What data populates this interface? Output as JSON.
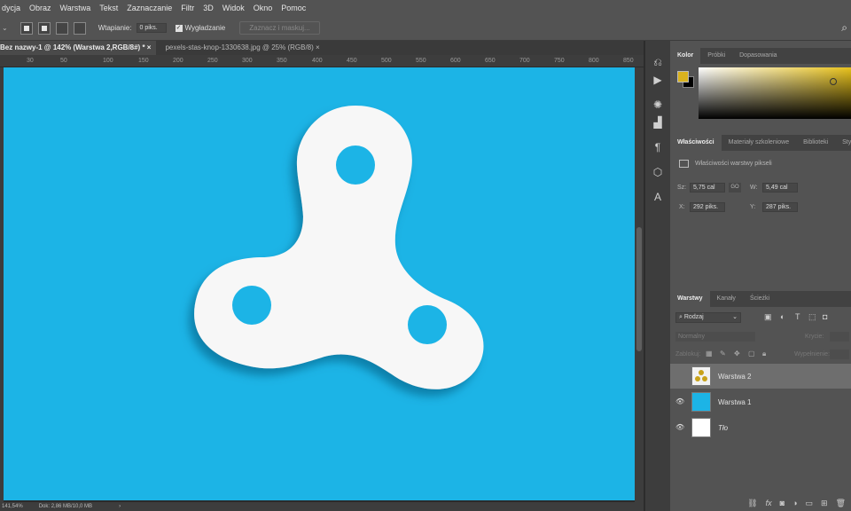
{
  "menu": [
    "dycja",
    "Obraz",
    "Warstwa",
    "Tekst",
    "Zaznaczanie",
    "Filtr",
    "3D",
    "Widok",
    "Okno",
    "Pomoc"
  ],
  "options": {
    "feather_label": "Wtapianie:",
    "feather_value": "0 piks.",
    "antialias_label": "Wygładzanie",
    "select_mask_label": "Zaznacz i maskuj..."
  },
  "tabs": [
    {
      "label": "Bez nazwy-1 @ 142% (Warstwa 2,RGB/8#) *",
      "close": "×"
    },
    {
      "label": "pexels-stas-knop-1330638.jpg @ 25% (RGB/8)",
      "close": "×"
    }
  ],
  "ruler_ticks": [
    "30",
    "50",
    "100",
    "150",
    "200",
    "250",
    "300",
    "350",
    "400",
    "450",
    "500",
    "550",
    "600",
    "650",
    "700",
    "750",
    "800",
    "850",
    "900"
  ],
  "status": {
    "zoom": "141,54%",
    "doc": "Dok: 2,86 MB/10,0 MB"
  },
  "color_panel": {
    "tabs": [
      "Kolor",
      "Próbki",
      "Dopasowania"
    ],
    "fg_color": "#d9b21f",
    "bg_color": "#000000"
  },
  "properties": {
    "tabs": [
      "Właściwości",
      "Materiały szkoleniowe",
      "Biblioteki",
      "Styl"
    ],
    "subtitle": "Właściwości warstwy pikseli",
    "w_label": "Sz:",
    "w_value": "5,75 cal",
    "h_label": "W:",
    "h_value": "5,49 cal",
    "x_label": "X:",
    "x_value": "292 piks.",
    "y_label": "Y:",
    "y_value": "287 piks.",
    "link_icon": "GO"
  },
  "layers": {
    "tabs": [
      "Warstwy",
      "Kanały",
      "Ścieżki"
    ],
    "filter_label": "Rodzaj",
    "blend_mode": "Normalny",
    "opacity_label": "Krycie:",
    "lock_label": "Zablokuj:",
    "fill_label": "Wypełnienie:",
    "items": [
      {
        "name": "Warstwa 2",
        "visible": false,
        "selected": true
      },
      {
        "name": "Warstwa 1",
        "visible": true,
        "selected": false
      },
      {
        "name": "Tło",
        "visible": true,
        "selected": false
      }
    ],
    "footer_icons": [
      "link-icon",
      "fx-icon",
      "mask-icon",
      "adjustment-icon",
      "group-icon",
      "new-layer-icon",
      "trash-icon"
    ],
    "fx_label": "fx"
  },
  "canvas": {
    "background_color": "#1cb4e6",
    "spinner_color": "#ffffff"
  }
}
